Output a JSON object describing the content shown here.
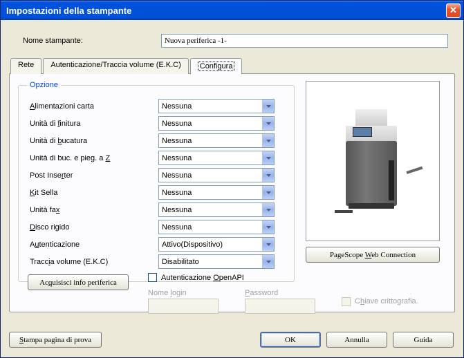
{
  "window": {
    "title": "Impostazioni della stampante",
    "close_glyph": "✕"
  },
  "name": {
    "label": "Nome stampante:",
    "value": "Nuova periferica -1-"
  },
  "tabs": {
    "rete": "Rete",
    "auth": "Autenticazione/Traccia volume (E.K.C)",
    "configura": "Configura"
  },
  "opzione": {
    "legend": "Opzione",
    "items": [
      {
        "label_pre": "",
        "u": "A",
        "label_post": "limentazioni carta",
        "value": "Nessuna"
      },
      {
        "label_pre": "Unità di ",
        "u": "f",
        "label_post": "initura",
        "value": "Nessuna"
      },
      {
        "label_pre": "Unità di ",
        "u": "b",
        "label_post": "ucatura",
        "value": "Nessuna"
      },
      {
        "label_pre": "Unità di buc. e pieg. a ",
        "u": "Z",
        "label_post": "",
        "value": "Nessuna"
      },
      {
        "label_pre": "Post Inse",
        "u": "r",
        "label_post": "ter",
        "value": "Nessuna"
      },
      {
        "label_pre": "",
        "u": "K",
        "label_post": "it Sella",
        "value": "Nessuna"
      },
      {
        "label_pre": "Unità fa",
        "u": "x",
        "label_post": "",
        "value": "Nessuna"
      },
      {
        "label_pre": "",
        "u": "D",
        "label_post": "isco rigido",
        "value": "Nessuna"
      },
      {
        "label_pre": "A",
        "u": "u",
        "label_post": "tenticazione",
        "value": "Attivo(Dispositivo)"
      },
      {
        "label_pre": "Tracc",
        "u": "i",
        "label_post": "a volume (E.K.C)",
        "value": "Disabilitato"
      }
    ]
  },
  "right": {
    "pagescope_pre": "PageScope ",
    "pagescope_u": "W",
    "pagescope_post": "eb Connection"
  },
  "info_btn": {
    "pre": "Ac",
    "u": "q",
    "post": "uisisci info periferica"
  },
  "openapi": {
    "pre": "Autenticazione ",
    "u": "O",
    "post": "penAPI",
    "login_pre": "Nome ",
    "login_u": "l",
    "login_post": "ogin",
    "password_pre": "",
    "password_u": "P",
    "password_post": "assword",
    "crypt_pre": "C",
    "crypt_u": "h",
    "crypt_post": "iave crittografia."
  },
  "footer": {
    "print_pre": "",
    "print_u": "S",
    "print_post": "tampa pagina di prova",
    "ok": "OK",
    "annulla": "Annulla",
    "guida": "Guida"
  }
}
